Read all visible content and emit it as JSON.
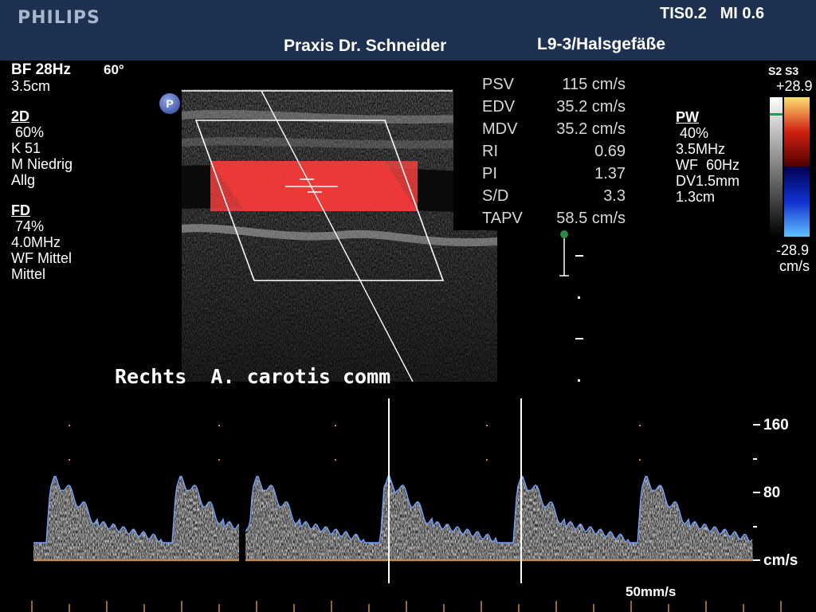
{
  "header": {
    "brand": "PHILIPS",
    "safety_index": "TIS0.2   MI 0.6",
    "institution": "Praxis Dr. Schneider",
    "probe_preset": "L9-3/Halsgefäße"
  },
  "left_params": {
    "frame_rate": "BF 28Hz",
    "angle": "60°",
    "depth": "3.5cm",
    "mode_2d": {
      "title": "2D",
      "gain": " 60%",
      "compression": "K 51",
      "persistence": "M Niedrig",
      "preset": "Allg"
    },
    "mode_fd": {
      "title": "FD",
      "gain": " 74%",
      "frequency": "4.0MHz",
      "wall_filter": "WF Mittel",
      "flow": "Mittel"
    }
  },
  "pw_params": {
    "title": "PW",
    "gain": " 40%",
    "frequency": "3.5MHz",
    "wall_filter": "WF  60Hz",
    "sample_volume": "DV1.5mm",
    "depth": "1.3cm"
  },
  "color_scale": {
    "label": "S2 S3",
    "max": "+28.9",
    "min": "-28.9",
    "unit": "cm/s"
  },
  "measurements": [
    {
      "label": "PSV",
      "value": "115 cm/s"
    },
    {
      "label": "EDV",
      "value": "35.2 cm/s"
    },
    {
      "label": "MDV",
      "value": "35.2 cm/s"
    },
    {
      "label": "RI",
      "value": "0.69"
    },
    {
      "label": "PI",
      "value": "1.37"
    },
    {
      "label": "S/D",
      "value": "3.3"
    },
    {
      "label": "TAPV",
      "value": "58.5 cm/s"
    }
  ],
  "badge": "P",
  "freeze_marker": "II",
  "caption": "Rechts  A. carotis comm",
  "spectrum_scale": {
    "top": "160",
    "mid": "80",
    "unit": "cm/s"
  },
  "sweep_speed": "50mm/s",
  "colors": {
    "header_bg": "#1d3050",
    "spectrum_line": "#6fa0ff",
    "baseline": "#c8874a",
    "color_flow": "#d01010"
  }
}
